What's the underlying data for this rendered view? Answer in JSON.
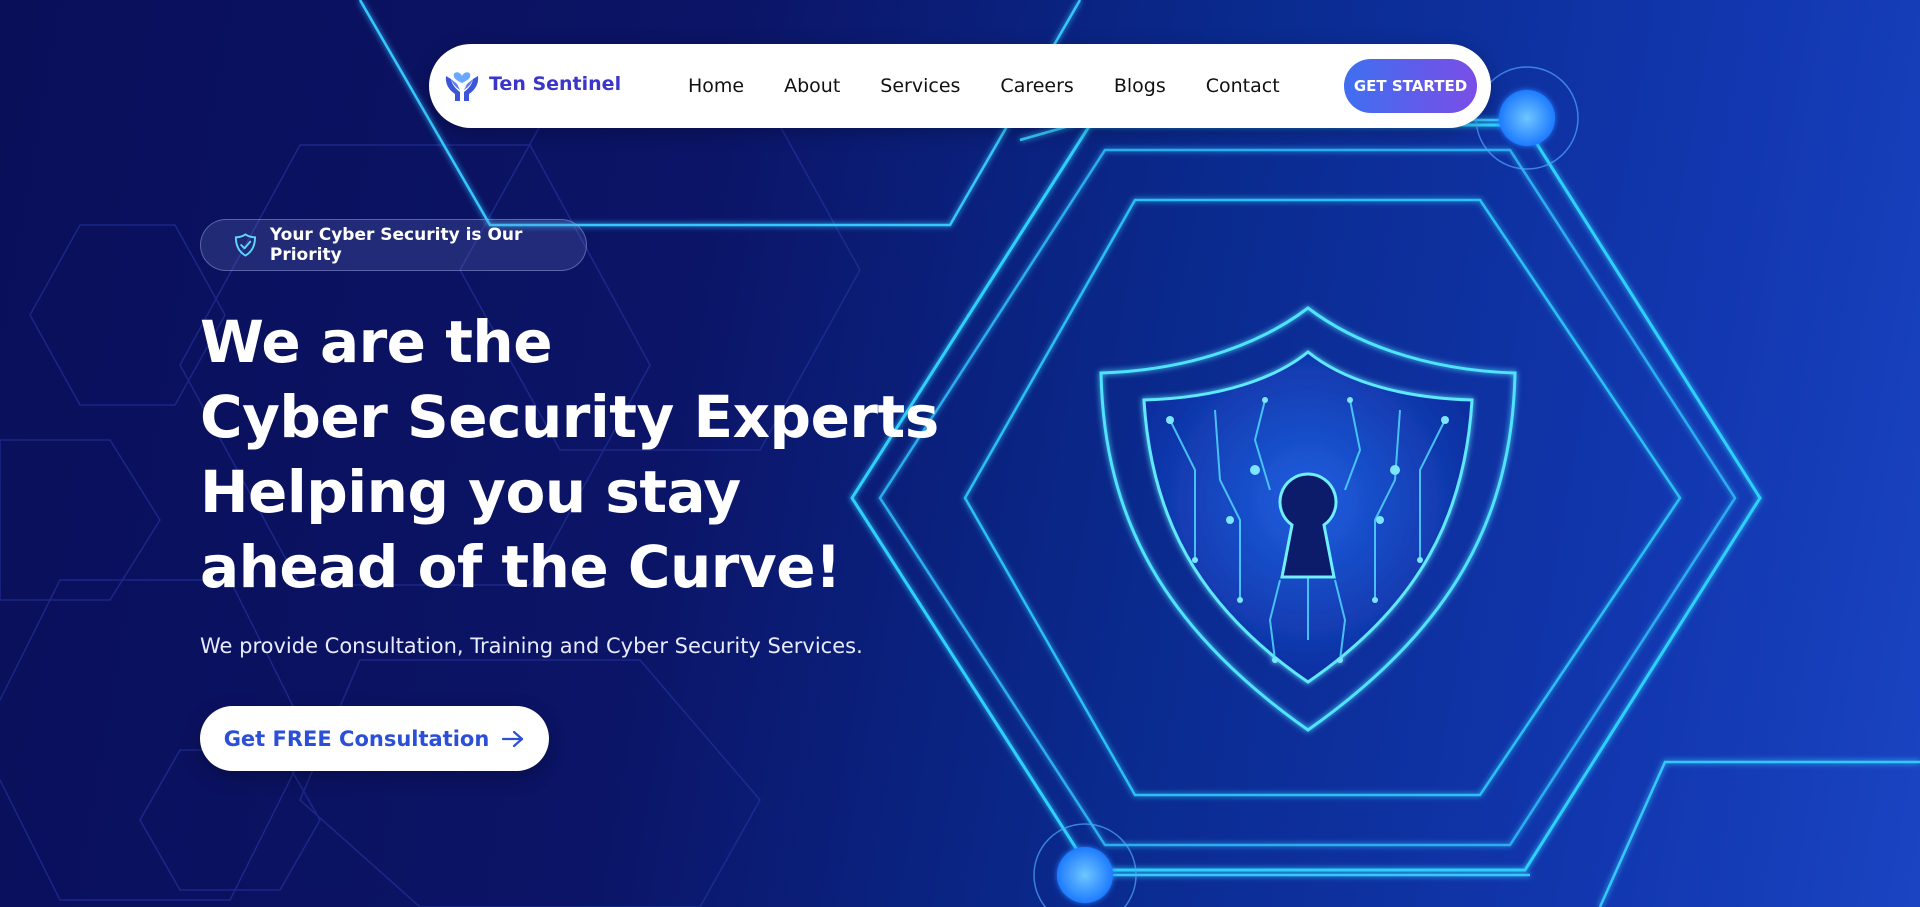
{
  "navbar": {
    "brand_name": "Ten Sentinel",
    "brand_icon": "hands-heart-icon",
    "links": [
      "Home",
      "About",
      "Services",
      "Careers",
      "Blogs",
      "Contact"
    ],
    "cta_label": "GET STARTED"
  },
  "hero": {
    "badge_icon": "shield-check-icon",
    "badge_text": "Your Cyber Security is Our Priority",
    "headline_lines": [
      "We are the",
      "Cyber Security Experts",
      "Helping you stay",
      "ahead of the Curve!"
    ],
    "subtext": "We provide Consultation, Training and Cyber Security Services.",
    "cta_label": "Get FREE Consultation",
    "cta_icon": "arrow-right-icon",
    "illustration_icon": "shield-keyhole-icon"
  },
  "colors": {
    "background_dark": "#0a0f5a",
    "background_light": "#1a44c2",
    "accent_cyan": "#3fd2ff",
    "brand_purple": "#3b35c9",
    "button_gradient_start": "#3f6ff0",
    "button_gradient_end": "#7a4ee6",
    "cta_text": "#2b4fd6"
  }
}
